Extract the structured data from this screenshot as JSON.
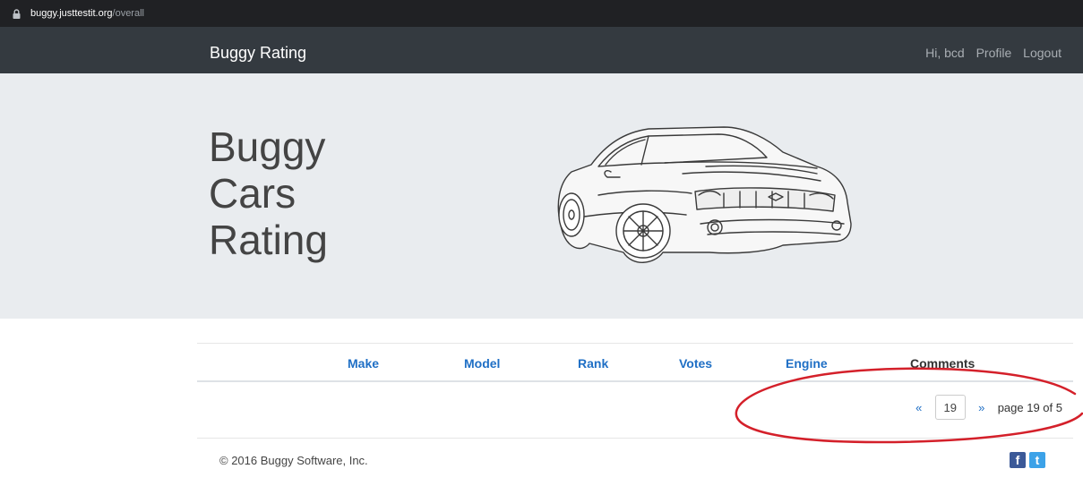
{
  "browser": {
    "url_host": "buggy.justtestit.org",
    "url_path": "/overall"
  },
  "navbar": {
    "brand": "Buggy Rating",
    "greeting": "Hi, bcd",
    "profile": "Profile",
    "logout": "Logout"
  },
  "hero": {
    "title_lines": [
      "Buggy",
      "Cars",
      "Rating"
    ]
  },
  "table": {
    "columns": [
      {
        "label": "Make",
        "sortable": true
      },
      {
        "label": "Model",
        "sortable": true
      },
      {
        "label": "Rank",
        "sortable": true
      },
      {
        "label": "Votes",
        "sortable": true
      },
      {
        "label": "Engine",
        "sortable": true
      },
      {
        "label": "Comments",
        "sortable": false
      }
    ]
  },
  "pagination": {
    "prev": "«",
    "current_page": "19",
    "next": "»",
    "status": "page 19 of 5"
  },
  "footer": {
    "copyright": "© 2016 Buggy Software, Inc.",
    "facebook_glyph": "f",
    "twitter_glyph": "t"
  },
  "colors": {
    "navbar_bg": "#343a40",
    "hero_bg": "#e9ecef",
    "link": "#1f6fc5",
    "annotation": "#d4202a",
    "facebook": "#3b5998",
    "twitter": "#3ca2e8"
  }
}
